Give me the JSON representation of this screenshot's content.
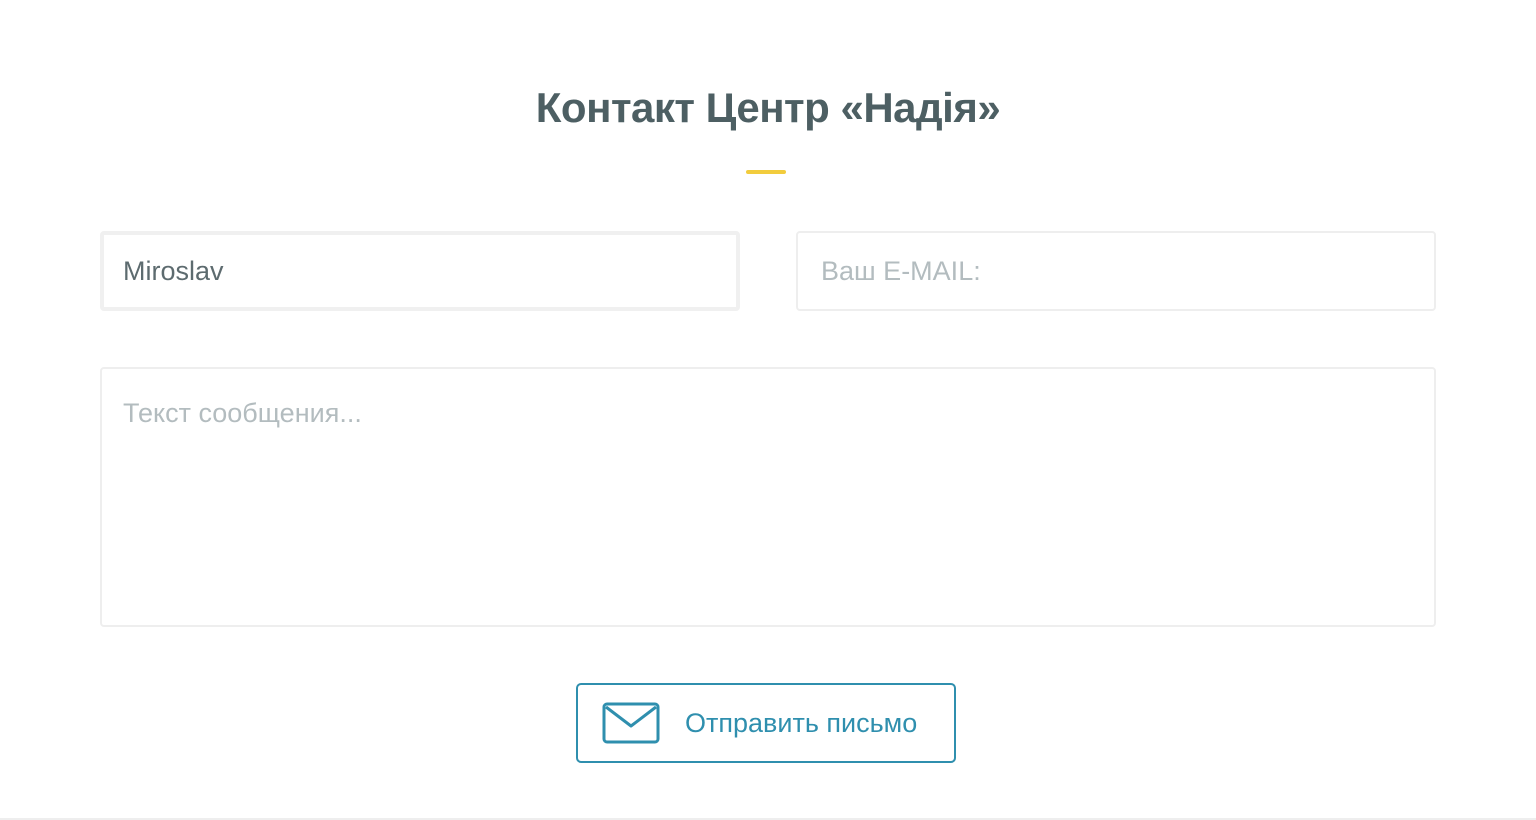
{
  "contact": {
    "title": "Контакт Центр «Надія»",
    "name_value": "Miroslav",
    "email_placeholder": "Ваш E-MAIL:",
    "email_value": "",
    "message_placeholder": "Текст сообщения...",
    "message_value": "",
    "send_label": "Отправить письмо",
    "send_icon": "envelope-icon"
  },
  "colors": {
    "title": "#4d5f63",
    "accent_underline": "#f2cc3d",
    "button": "#2f8fae",
    "placeholder": "#b3bcbf",
    "field_border": "#eeeeee"
  }
}
